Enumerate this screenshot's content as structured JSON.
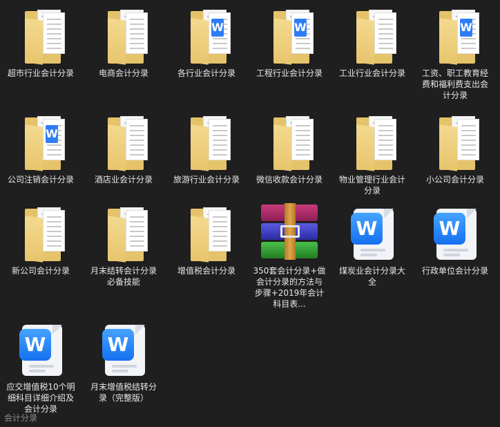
{
  "items": [
    {
      "name": "超市行业会计分录",
      "type": "folder"
    },
    {
      "name": "电商会计分录",
      "type": "folder"
    },
    {
      "name": "各行业会计分录",
      "type": "folder-word"
    },
    {
      "name": "工程行业会计分录",
      "type": "folder-word"
    },
    {
      "name": "工业行业会计分录",
      "type": "folder"
    },
    {
      "name": "工资、职工教育经费和福利费支出会计分录",
      "type": "folder-word"
    },
    {
      "name": "公司注销会计分录",
      "type": "folder-word"
    },
    {
      "name": "酒店业会计分录",
      "type": "folder"
    },
    {
      "name": "旅游行业会计分录",
      "type": "folder"
    },
    {
      "name": "微信收款会计分录",
      "type": "folder"
    },
    {
      "name": "物业管理行业会计分录",
      "type": "folder"
    },
    {
      "name": "小公司会计分录",
      "type": "folder"
    },
    {
      "name": "新公司会计分录",
      "type": "folder"
    },
    {
      "name": "月末结转会计分录必备技能",
      "type": "folder"
    },
    {
      "name": "增值税会计分录",
      "type": "folder"
    },
    {
      "name": "350套会计分录+做会计分录的方法与步骤+2019年会计科目表...",
      "type": "rar"
    },
    {
      "name": "煤炭业会计分录大全",
      "type": "word"
    },
    {
      "name": "行政单位会计分录",
      "type": "word"
    },
    {
      "name": "应交增值税10个明细科目详细介绍及会计分录",
      "type": "word"
    },
    {
      "name": "月末增值税结转分录（完整版）",
      "type": "word"
    }
  ],
  "watermark": "会计分录",
  "icon_letter": "W",
  "colors": {
    "background": "#1f1f1f",
    "folder": "#e5c36a",
    "word_blue": "#1570f0"
  }
}
